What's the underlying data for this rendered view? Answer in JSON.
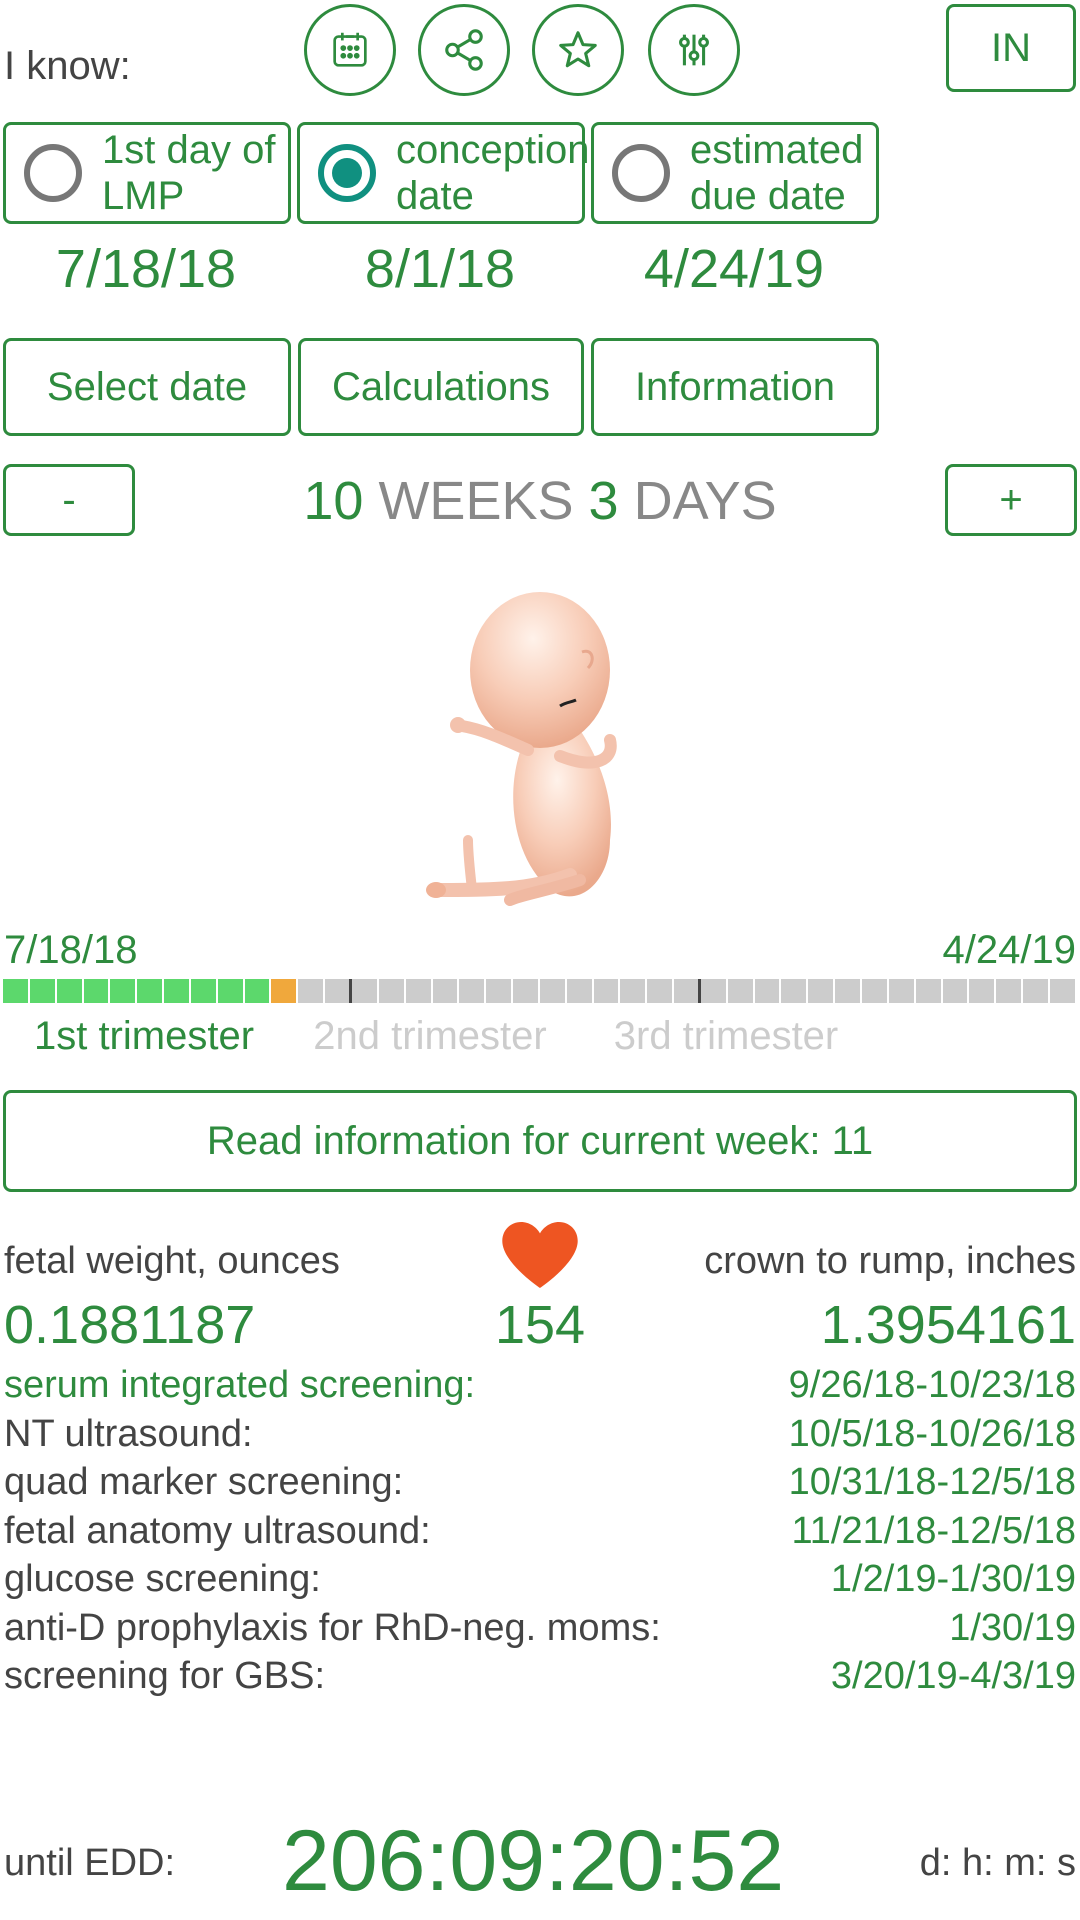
{
  "header": {
    "i_know_label": "I know:",
    "icons": [
      "calendar-icon",
      "share-icon",
      "star-icon",
      "sliders-icon"
    ],
    "units_button": "IN"
  },
  "know_options": [
    {
      "label": "1st day of\nLMP",
      "checked": false,
      "date": "7/18/18"
    },
    {
      "label": "conception\ndate",
      "checked": true,
      "date": "8/1/18"
    },
    {
      "label": "estimated\ndue date",
      "checked": false,
      "date": "4/24/19"
    }
  ],
  "actions": {
    "select_date": "Select date",
    "calculations": "Calculations",
    "information": "Information"
  },
  "stepper": {
    "minus": "-",
    "plus": "+",
    "weeks": "10",
    "weeks_label": "WEEKS",
    "days": "3",
    "days_label": "DAYS"
  },
  "timeline": {
    "start_date": "7/18/18",
    "end_date": "4/24/19",
    "total_weeks": 40,
    "completed_weeks": 10,
    "current_week_index": 11,
    "trimester_dividers_after_week": [
      13,
      26
    ],
    "trimesters": [
      {
        "label": "1st trimester",
        "active": true
      },
      {
        "label": "2nd trimester",
        "active": false
      },
      {
        "label": "3rd trimester",
        "active": false
      }
    ],
    "colors": {
      "done": "#5cd86c",
      "current": "#f0a83c",
      "remaining": "#cccccc"
    }
  },
  "read_info_button": "Read information for current week: 11",
  "stats": {
    "weight_label": "fetal weight, ounces",
    "weight_value": "0.1881187",
    "heart_rate": "154",
    "crl_label": "crown to rump, inches",
    "crl_value": "1.3954161"
  },
  "screenings": [
    {
      "name": "serum integrated screening:",
      "range": "9/26/18-10/23/18",
      "highlight": true
    },
    {
      "name": "NT ultrasound:",
      "range": "10/5/18-10/26/18",
      "highlight": false
    },
    {
      "name": "quad marker screening:",
      "range": "10/31/18-12/5/18",
      "highlight": false
    },
    {
      "name": "fetal anatomy ultrasound:",
      "range": "11/21/18-12/5/18",
      "highlight": false
    },
    {
      "name": "glucose screening:",
      "range": "1/2/19-1/30/19",
      "highlight": false
    },
    {
      "name": "anti-D prophylaxis for RhD-neg. moms:",
      "range": "1/30/19",
      "highlight": false
    },
    {
      "name": "screening for GBS:",
      "range": "3/20/19-4/3/19",
      "highlight": false
    }
  ],
  "countdown": {
    "label": "until EDD:",
    "value": "206:09:20:52",
    "units": "d: h: m: s"
  },
  "theme": {
    "accent": "#2e8b3e",
    "radio_checked": "#109080",
    "heart": "#ee5522"
  }
}
